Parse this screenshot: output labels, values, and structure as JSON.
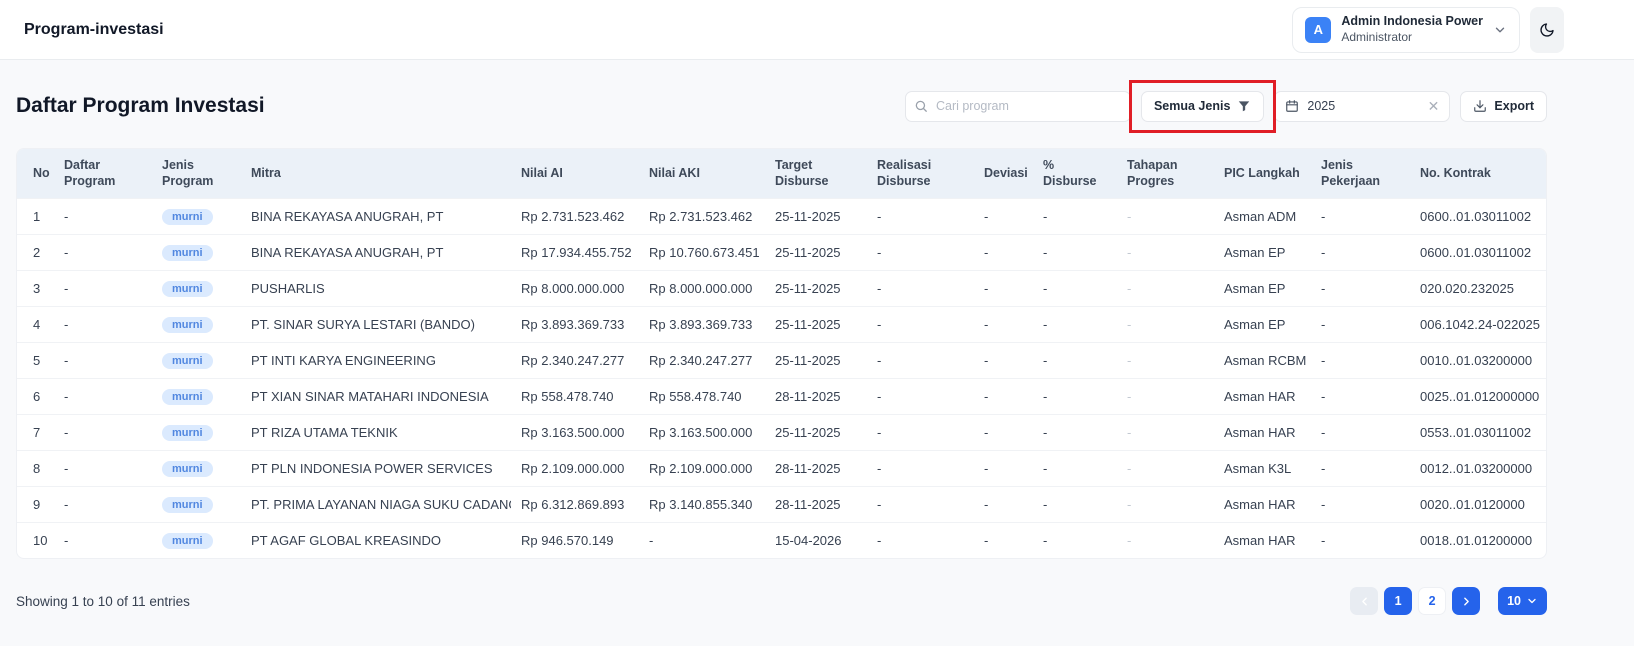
{
  "header": {
    "title": "Program-investasi",
    "user": {
      "initial": "A",
      "name": "Admin Indonesia Power",
      "role": "Administrator"
    }
  },
  "toolbar": {
    "page_title": "Daftar Program Investasi",
    "search_placeholder": "Cari program",
    "filter_label": "Semua Jenis",
    "year_value": "2025",
    "export_label": "Export"
  },
  "table": {
    "columns": [
      "No",
      "Daftar Program",
      "Jenis Program",
      "Mitra",
      "Nilai AI",
      "Nilai AKI",
      "Target Disburse",
      "Realisasi Disburse",
      "Deviasi",
      "% Disburse",
      "Tahapan Progres",
      "PIC Langkah",
      "Jenis Pekerjaan",
      "No. Kontrak"
    ],
    "rows": [
      {
        "no": "1",
        "daftar_program": "-",
        "jenis_program": "murni",
        "mitra": "BINA REKAYASA ANUGRAH, PT",
        "nilai_ai": "Rp 2.731.523.462",
        "nilai_aki": "Rp 2.731.523.462",
        "target_disburse": "25-11-2025",
        "realisasi_disburse": "-",
        "deviasi": "-",
        "pct_disburse": "-",
        "tahapan_progres": "-",
        "pic_langkah": "Asman ADM",
        "jenis_pekerjaan": "-",
        "no_kontrak": "0600..01.03011002"
      },
      {
        "no": "2",
        "daftar_program": "-",
        "jenis_program": "murni",
        "mitra": "BINA REKAYASA ANUGRAH, PT",
        "nilai_ai": "Rp 17.934.455.752",
        "nilai_aki": "Rp 10.760.673.451",
        "target_disburse": "25-11-2025",
        "realisasi_disburse": "-",
        "deviasi": "-",
        "pct_disburse": "-",
        "tahapan_progres": "-",
        "pic_langkah": "Asman EP",
        "jenis_pekerjaan": "-",
        "no_kontrak": "0600..01.03011002"
      },
      {
        "no": "3",
        "daftar_program": "-",
        "jenis_program": "murni",
        "mitra": "PUSHARLIS",
        "nilai_ai": "Rp 8.000.000.000",
        "nilai_aki": "Rp 8.000.000.000",
        "target_disburse": "25-11-2025",
        "realisasi_disburse": "-",
        "deviasi": "-",
        "pct_disburse": "-",
        "tahapan_progres": "-",
        "pic_langkah": "Asman EP",
        "jenis_pekerjaan": "-",
        "no_kontrak": "020.020.232025"
      },
      {
        "no": "4",
        "daftar_program": "-",
        "jenis_program": "murni",
        "mitra": "PT. SINAR SURYA LESTARI (BANDO)",
        "nilai_ai": "Rp 3.893.369.733",
        "nilai_aki": "Rp 3.893.369.733",
        "target_disburse": "25-11-2025",
        "realisasi_disburse": "-",
        "deviasi": "-",
        "pct_disburse": "-",
        "tahapan_progres": "-",
        "pic_langkah": "Asman EP",
        "jenis_pekerjaan": "-",
        "no_kontrak": "006.1042.24-022025"
      },
      {
        "no": "5",
        "daftar_program": "-",
        "jenis_program": "murni",
        "mitra": "PT INTI KARYA ENGINEERING",
        "nilai_ai": "Rp 2.340.247.277",
        "nilai_aki": "Rp 2.340.247.277",
        "target_disburse": "25-11-2025",
        "realisasi_disburse": "-",
        "deviasi": "-",
        "pct_disburse": "-",
        "tahapan_progres": "-",
        "pic_langkah": "Asman RCBM",
        "jenis_pekerjaan": "-",
        "no_kontrak": "0010..01.03200000"
      },
      {
        "no": "6",
        "daftar_program": "-",
        "jenis_program": "murni",
        "mitra": "PT XIAN SINAR MATAHARI INDONESIA",
        "nilai_ai": "Rp 558.478.740",
        "nilai_aki": "Rp 558.478.740",
        "target_disburse": "28-11-2025",
        "realisasi_disburse": "-",
        "deviasi": "-",
        "pct_disburse": "-",
        "tahapan_progres": "-",
        "pic_langkah": "Asman HAR",
        "jenis_pekerjaan": "-",
        "no_kontrak": "0025..01.012000000"
      },
      {
        "no": "7",
        "daftar_program": "-",
        "jenis_program": "murni",
        "mitra": "PT RIZA UTAMA TEKNIK",
        "nilai_ai": "Rp 3.163.500.000",
        "nilai_aki": "Rp 3.163.500.000",
        "target_disburse": "25-11-2025",
        "realisasi_disburse": "-",
        "deviasi": "-",
        "pct_disburse": "-",
        "tahapan_progres": "-",
        "pic_langkah": "Asman HAR",
        "jenis_pekerjaan": "-",
        "no_kontrak": "0553..01.03011002"
      },
      {
        "no": "8",
        "daftar_program": "-",
        "jenis_program": "murni",
        "mitra": "PT PLN INDONESIA POWER SERVICES",
        "nilai_ai": "Rp 2.109.000.000",
        "nilai_aki": "Rp 2.109.000.000",
        "target_disburse": "28-11-2025",
        "realisasi_disburse": "-",
        "deviasi": "-",
        "pct_disburse": "-",
        "tahapan_progres": "-",
        "pic_langkah": "Asman K3L",
        "jenis_pekerjaan": "-",
        "no_kontrak": "0012..01.03200000"
      },
      {
        "no": "9",
        "daftar_program": "-",
        "jenis_program": "murni",
        "mitra": "PT. PRIMA LAYANAN NIAGA SUKU CADANG",
        "nilai_ai": "Rp 6.312.869.893",
        "nilai_aki": "Rp 3.140.855.340",
        "target_disburse": "28-11-2025",
        "realisasi_disburse": "-",
        "deviasi": "-",
        "pct_disburse": "-",
        "tahapan_progres": "-",
        "pic_langkah": "Asman HAR",
        "jenis_pekerjaan": "-",
        "no_kontrak": "0020..01.0120000"
      },
      {
        "no": "10",
        "daftar_program": "-",
        "jenis_program": "murni",
        "mitra": "PT AGAF GLOBAL KREASINDO",
        "nilai_ai": "Rp 946.570.149",
        "nilai_aki": "-",
        "target_disburse": "15-04-2026",
        "realisasi_disburse": "-",
        "deviasi": "-",
        "pct_disburse": "-",
        "tahapan_progres": "-",
        "pic_langkah": "Asman HAR",
        "jenis_pekerjaan": "-",
        "no_kontrak": "0018..01.01200000"
      }
    ]
  },
  "footer": {
    "showing_text": "Showing 1 to 10 of 11 entries",
    "pages": [
      "1",
      "2"
    ],
    "active_page": "1",
    "page_size": "10"
  },
  "icons": {
    "search": "search-icon",
    "filter": "filter-funnel-icon",
    "calendar": "calendar-icon",
    "clear": "clear-x-icon",
    "export": "download-icon",
    "moon": "moon-icon",
    "chevron_down": "chevron-down-icon",
    "chevron_left": "chevron-left-icon",
    "chevron_right": "chevron-right-icon"
  },
  "colors": {
    "accent": "#2563eb",
    "badge_bg": "#dbeafe",
    "badge_text": "#5187e0",
    "annotation_red": "#e01e26",
    "table_header_bg": "#ebf1f8"
  }
}
